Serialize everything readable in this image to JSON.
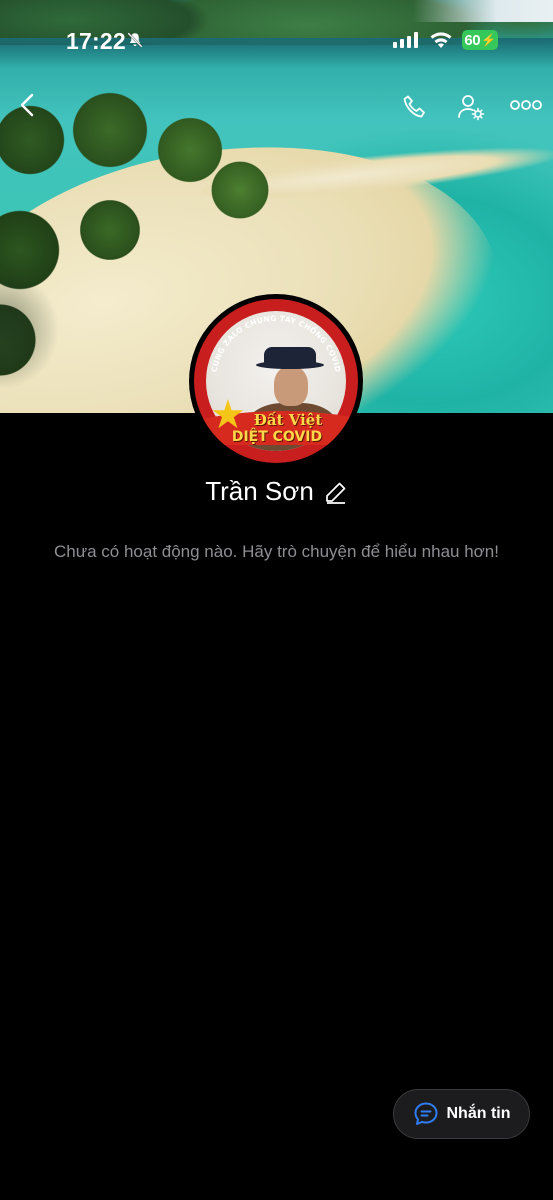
{
  "status_bar": {
    "time": "17:22",
    "battery": "60",
    "icons": [
      "bell-slash-icon",
      "signal-icon",
      "wifi-icon",
      "battery-charging-icon"
    ]
  },
  "header": {
    "actions": [
      "back-icon",
      "phone-icon",
      "user-settings-icon",
      "more-icon"
    ]
  },
  "profile": {
    "name": "Trần Sơn",
    "avatar_text": {
      "ring": "CÙNG ZALO CHUNG TAY CHỐNG COVID",
      "line1": "Đất Việt",
      "line2": "DIỆT COVID"
    },
    "empty_message": "Chưa có hoạt động nào. Hãy trò chuyện để hiểu nhau hơn!"
  },
  "actions": {
    "message_label": "Nhắn tin"
  },
  "colors": {
    "background": "#000000",
    "accent": "#2f7cf6",
    "battery": "#34c759",
    "muted_text": "#8e8e93"
  }
}
